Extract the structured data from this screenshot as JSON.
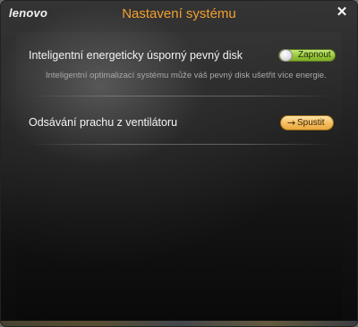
{
  "window": {
    "logo": "lenovo",
    "title": "Nastavení systému",
    "close": "✕"
  },
  "settings": [
    {
      "label": "Inteligentní energeticky úsporný pevný disk",
      "description": "Inteligentní optimalizací systému může váš pevný disk ušetřit více energie.",
      "control": {
        "type": "toggle",
        "state": "on",
        "label": "Zapnout",
        "color": "#9dcb3e"
      }
    },
    {
      "label": "Odsávání prachu z ventilátoru",
      "control": {
        "type": "button",
        "icon": "arrow-right-icon",
        "arrow": "→",
        "label": "Spustit",
        "color": "#f5c063"
      }
    }
  ],
  "colors": {
    "accent_title": "#f0a030",
    "background": "#1a1a1a"
  }
}
